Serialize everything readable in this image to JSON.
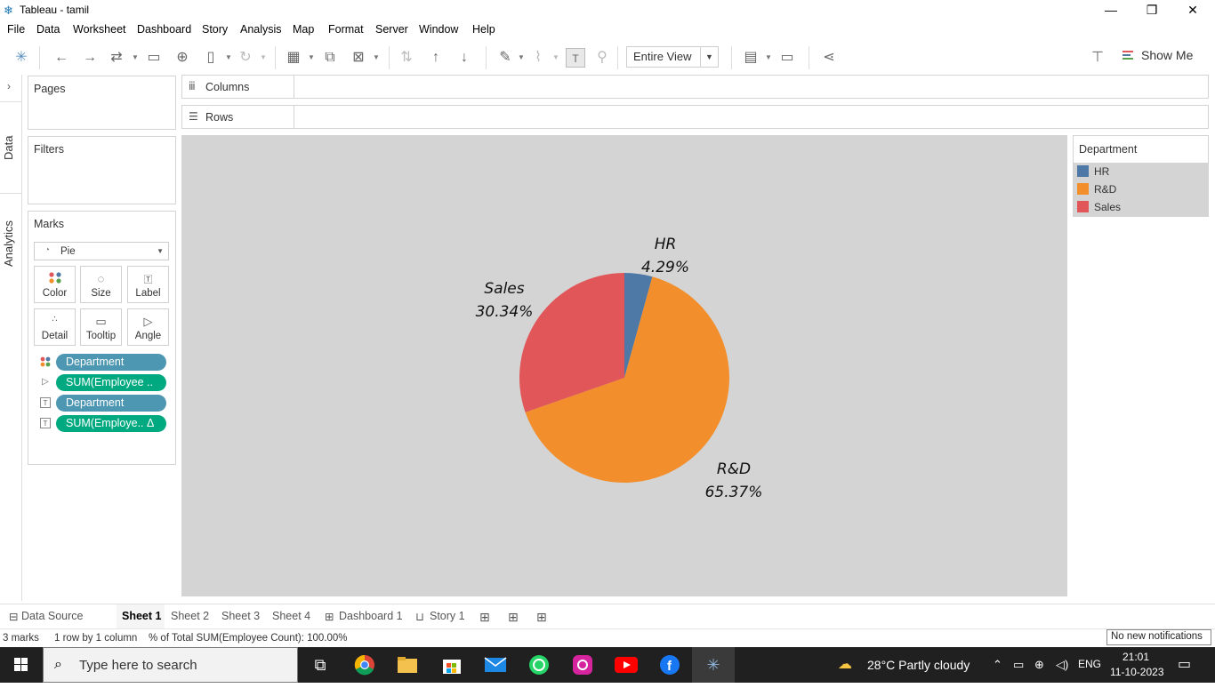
{
  "window": {
    "title": "Tableau - tamil",
    "app_icon": "tableau-logo-icon"
  },
  "menu": [
    "File",
    "Data",
    "Worksheet",
    "Dashboard",
    "Story",
    "Analysis",
    "Map",
    "Format",
    "Server",
    "Window",
    "Help"
  ],
  "toolbar": {
    "fit_value": "Entire View",
    "show_me_label": "Show Me"
  },
  "side_tabs": {
    "data": "Data",
    "analytics": "Analytics"
  },
  "panels": {
    "pages": "Pages",
    "filters": "Filters",
    "marks": "Marks"
  },
  "marks": {
    "type": "Pie",
    "buttons": [
      "Color",
      "Size",
      "Label",
      "Detail",
      "Tooltip",
      "Angle"
    ],
    "pills": [
      {
        "label": "Department",
        "kind": "dimension",
        "encoding": "color"
      },
      {
        "label": "SUM(Employee ..",
        "kind": "measure",
        "encoding": "angle"
      },
      {
        "label": "Department",
        "kind": "dimension",
        "encoding": "label"
      },
      {
        "label": "SUM(Employe.. Δ",
        "kind": "measure",
        "encoding": "label"
      }
    ]
  },
  "shelves": {
    "columns": "Columns",
    "rows": "Rows"
  },
  "legend": {
    "title": "Department",
    "items": [
      {
        "label": "HR",
        "color": "#4e79a7"
      },
      {
        "label": "R&D",
        "color": "#f28e2b"
      },
      {
        "label": "Sales",
        "color": "#e15759"
      }
    ]
  },
  "chart_data": {
    "type": "pie",
    "categories": [
      "HR",
      "R&D",
      "Sales"
    ],
    "values": [
      4.29,
      65.37,
      30.34
    ],
    "value_labels": [
      "4.29%",
      "65.37%",
      "30.34%"
    ],
    "colors": [
      "#4e79a7",
      "#f28e2b",
      "#e15759"
    ],
    "legend_title": "Department"
  },
  "sheet_tabs": {
    "data_source": "Data Source",
    "tabs": [
      "Sheet 1",
      "Sheet 2",
      "Sheet 3",
      "Sheet 4",
      "Dashboard 1",
      "Story 1"
    ],
    "active": "Sheet 1"
  },
  "status": {
    "marks": "3 marks",
    "dims": "1 row by 1 column",
    "summary": "% of Total SUM(Employee Count): 100.00%",
    "notification": "No new notifications"
  },
  "taskbar": {
    "search_placeholder": "Type here to search",
    "weather": "28°C  Partly cloudy",
    "language": "ENG",
    "time": "21:01",
    "date": "11-10-2023"
  }
}
